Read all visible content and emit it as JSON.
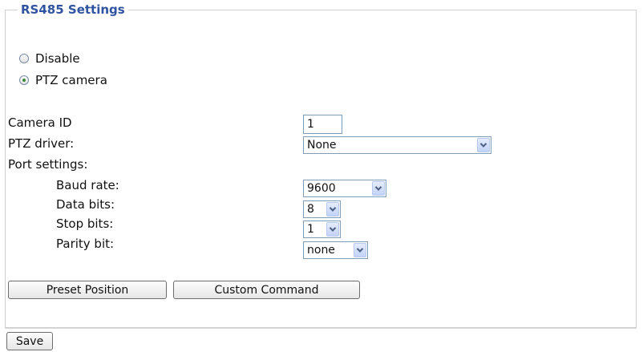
{
  "section": {
    "title": "RS485 Settings"
  },
  "mode": {
    "options": [
      "Disable",
      "PTZ camera"
    ],
    "selected": "PTZ camera"
  },
  "form": {
    "camera_id_label": "Camera ID",
    "camera_id_value": "1",
    "ptz_driver_label": "PTZ driver:",
    "ptz_driver_value": "None",
    "port_settings_label": "Port settings:",
    "baud_rate_label": "Baud rate:",
    "baud_rate_value": "9600",
    "data_bits_label": "Data bits:",
    "data_bits_value": "8",
    "stop_bits_label": "Stop bits:",
    "stop_bits_value": "1",
    "parity_bit_label": "Parity bit:",
    "parity_bit_value": "none"
  },
  "actions": {
    "preset_position_label": "Preset Position",
    "custom_command_label": "Custom Command",
    "save_label": "Save"
  }
}
